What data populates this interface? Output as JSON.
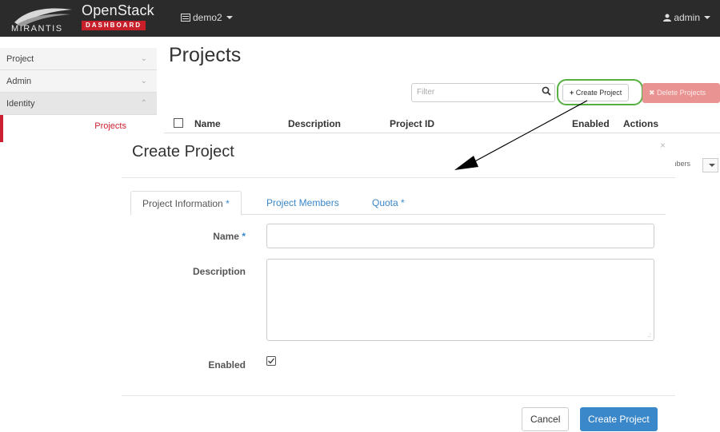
{
  "header": {
    "brand_mirantis": "MIRANTIS",
    "brand_openstack": "OpenStack",
    "brand_dashboard": "DASHBOARD",
    "project_switcher": "demo2",
    "user_menu": "admin"
  },
  "sidebar": {
    "items": [
      {
        "label": "Project",
        "chevron": "⌄"
      },
      {
        "label": "Admin",
        "chevron": "⌄"
      },
      {
        "label": "Identity",
        "chevron": "⌃"
      }
    ],
    "active_sub": "Projects"
  },
  "page": {
    "title": "Projects",
    "filter_placeholder": "Filter",
    "create_button": "Create Project",
    "delete_button": "Delete Projects",
    "table_headers": [
      "Name",
      "Description",
      "Project ID",
      "Enabled",
      "Actions"
    ],
    "row_action_partial": "mbers"
  },
  "modal": {
    "title": "Create Project",
    "close": "×",
    "tabs": [
      {
        "label": "Project Information",
        "required": "*"
      },
      {
        "label": "Project Members",
        "required": ""
      },
      {
        "label": "Quota",
        "required": "*"
      }
    ],
    "fields": {
      "name_label": "Name",
      "name_required": "*",
      "name_value": "",
      "description_label": "Description",
      "description_value": "",
      "enabled_label": "Enabled",
      "enabled_checked": true
    },
    "cancel_button": "Cancel",
    "submit_button": "Create Project"
  },
  "colors": {
    "topbar": "#2b2b2b",
    "brand_red": "#c8202b",
    "link_blue": "#3a87c9",
    "highlight_green": "#55b040"
  }
}
